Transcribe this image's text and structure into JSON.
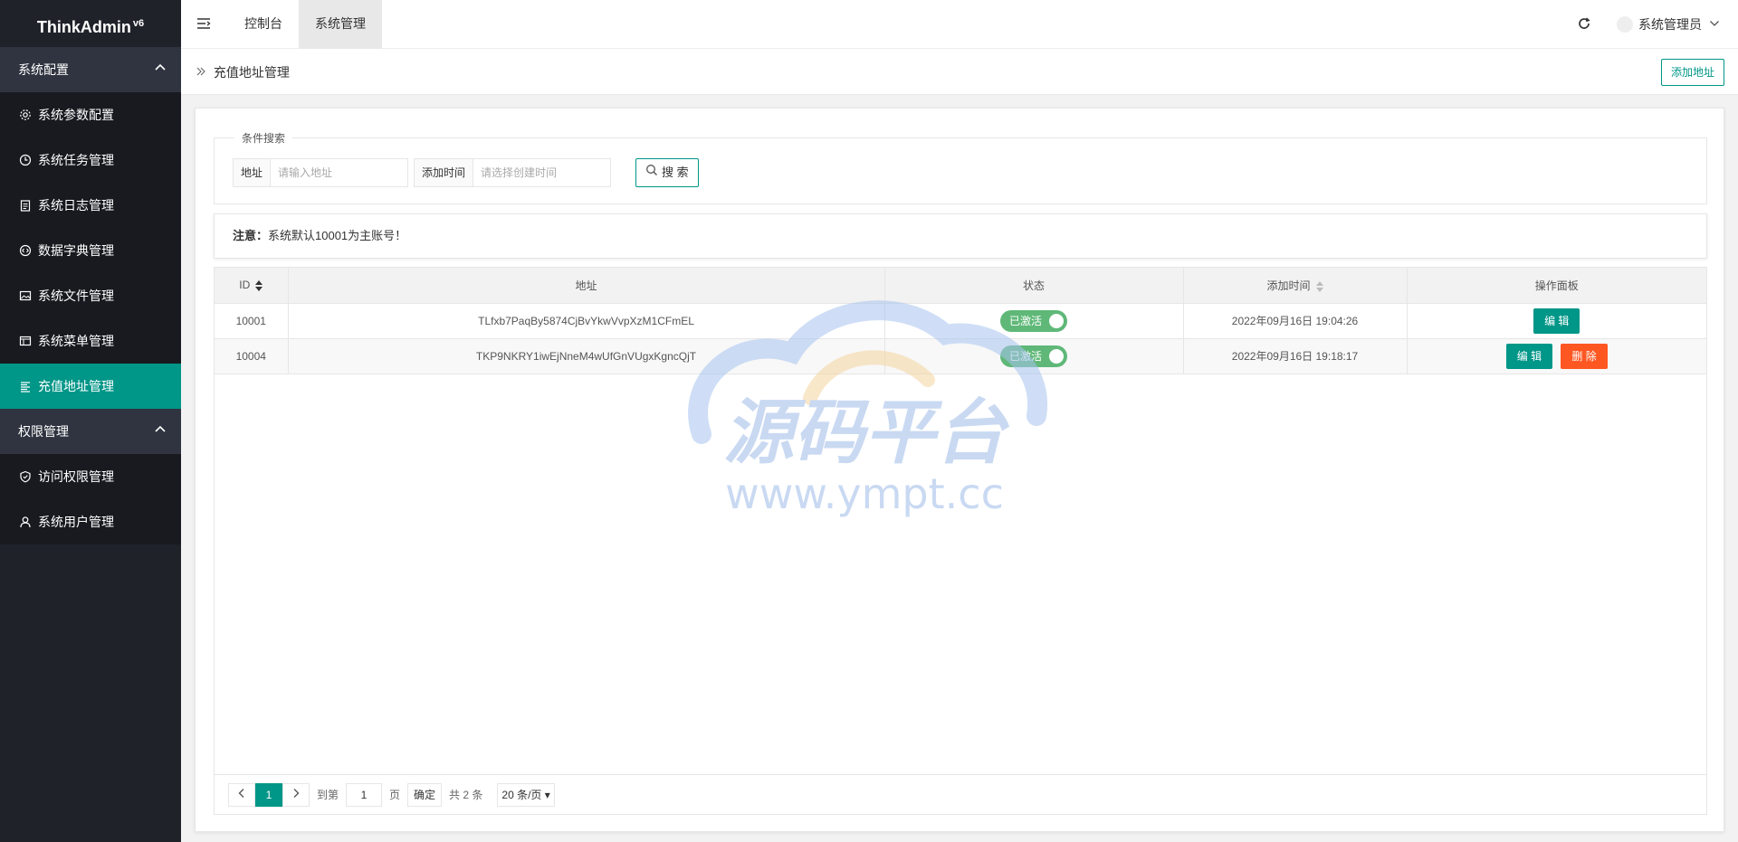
{
  "app": {
    "logo": "ThinkAdmin",
    "version": "v6"
  },
  "sidebar": {
    "groups": [
      {
        "title": "系统配置",
        "items": [
          {
            "label": "系统参数配置",
            "icon": "gear-icon"
          },
          {
            "label": "系统任务管理",
            "icon": "clock-icon"
          },
          {
            "label": "系统日志管理",
            "icon": "clipboard-icon"
          },
          {
            "label": "数据字典管理",
            "icon": "code-circle-icon"
          },
          {
            "label": "系统文件管理",
            "icon": "image-icon"
          },
          {
            "label": "系统菜单管理",
            "icon": "window-icon"
          },
          {
            "label": "充值地址管理",
            "icon": "list-icon",
            "active": true
          }
        ]
      },
      {
        "title": "权限管理",
        "items": [
          {
            "label": "访问权限管理",
            "icon": "shield-icon"
          },
          {
            "label": "系统用户管理",
            "icon": "user-icon"
          }
        ]
      }
    ]
  },
  "topbar": {
    "tabs": [
      "控制台",
      "系统管理"
    ],
    "active_tab": "系统管理",
    "user": "系统管理员"
  },
  "breadcrumb": {
    "title": "充值地址管理",
    "add_button": "添加地址"
  },
  "search": {
    "legend": "条件搜索",
    "address_label": "地址",
    "address_placeholder": "请输入地址",
    "time_label": "添加时间",
    "time_placeholder": "请选择创建时间",
    "button": "搜 索"
  },
  "notice": {
    "prefix": "注意：",
    "text": "系统默认10001为主账号！"
  },
  "table": {
    "headers": {
      "id": "ID",
      "address": "地址",
      "status": "状态",
      "time": "添加时间",
      "actions": "操作面板"
    },
    "rows": [
      {
        "id": "10001",
        "address": "TLfxb7PaqBy5874CjBvYkwVvpXzM1CFmEL",
        "status": "已激活",
        "time": "2022年09月16日 19:04:26",
        "edit": "编 辑"
      },
      {
        "id": "10004",
        "address": "TKP9NKRY1iwEjNneM4wUfGnVUgxKgncQjT",
        "status": "已激活",
        "time": "2022年09月16日 19:18:17",
        "edit": "编 辑",
        "delete": "删 除"
      }
    ]
  },
  "pager": {
    "current": "1",
    "goto_label": "到第",
    "goto_value": "1",
    "page_unit": "页",
    "confirm": "确定",
    "total": "共 2 条",
    "per_page": "20 条/页"
  },
  "watermark": {
    "title": "源码平台",
    "url": "www.ympt.cc"
  },
  "colors": {
    "accent": "#009688",
    "sidebar_bg": "#20222a",
    "danger": "#ff5722",
    "switch_on": "#5fb878"
  }
}
